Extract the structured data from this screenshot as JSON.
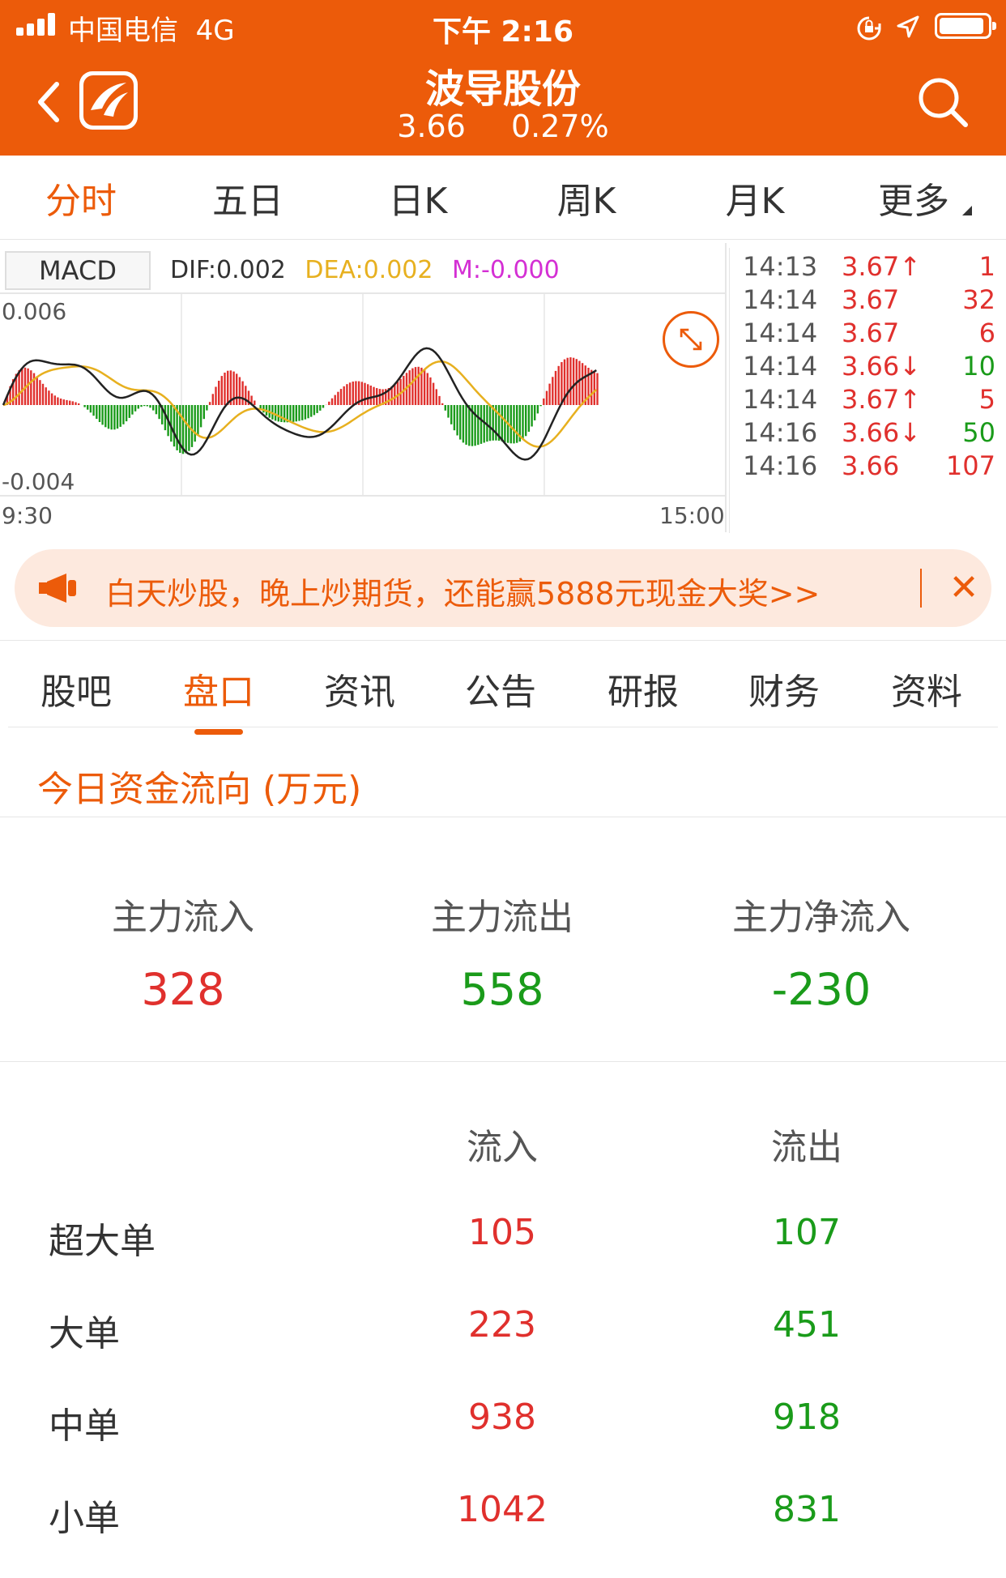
{
  "status_bar": {
    "carrier": "中国电信",
    "network": "4G",
    "time": "下午 2:16"
  },
  "header": {
    "title": "波导股份",
    "price": "3.66",
    "change_pct": "0.27%"
  },
  "chart_tabs": [
    "分时",
    "五日",
    "日K",
    "周K",
    "月K",
    "更多"
  ],
  "chart_tabs_active": "分时",
  "macd": {
    "button": "MACD",
    "dif": "DIF:0.002",
    "dea": "DEA:0.002",
    "m": "M:-0.000",
    "y_top": "0.006",
    "y_bottom": "-0.004",
    "x_start": "9:30",
    "x_end": "15:00"
  },
  "ticks": [
    {
      "time": "14:13",
      "price": "3.67↑",
      "vol": "1",
      "price_color": "red",
      "vol_color": "red"
    },
    {
      "time": "14:14",
      "price": "3.67",
      "vol": "32",
      "price_color": "red",
      "vol_color": "red"
    },
    {
      "time": "14:14",
      "price": "3.67",
      "vol": "6",
      "price_color": "red",
      "vol_color": "red"
    },
    {
      "time": "14:14",
      "price": "3.66↓",
      "vol": "10",
      "price_color": "red",
      "vol_color": "green"
    },
    {
      "time": "14:14",
      "price": "3.67↑",
      "vol": "5",
      "price_color": "red",
      "vol_color": "red"
    },
    {
      "time": "14:16",
      "price": "3.66↓",
      "vol": "50",
      "price_color": "red",
      "vol_color": "green"
    },
    {
      "time": "14:16",
      "price": "3.66",
      "vol": "107",
      "price_color": "red",
      "vol_color": "red"
    }
  ],
  "banner": {
    "text": "白天炒股，晚上炒期货，还能赢5888元现金大奖>>",
    "close": "✕"
  },
  "section_tabs": [
    "股吧",
    "盘口",
    "资讯",
    "公告",
    "研报",
    "财务",
    "资料"
  ],
  "section_tabs_active": "盘口",
  "fund_flow": {
    "title": "今日资金流向 (万元)",
    "main": [
      {
        "label": "主力流入",
        "value": "328",
        "color": "red"
      },
      {
        "label": "主力流出",
        "value": "558",
        "color": "green"
      },
      {
        "label": "主力净流入",
        "value": "-230",
        "color": "green"
      }
    ],
    "col_in": "流入",
    "col_out": "流出",
    "rows": [
      {
        "label": "超大单",
        "in": "105",
        "out": "107"
      },
      {
        "label": "大单",
        "in": "223",
        "out": "451"
      },
      {
        "label": "中单",
        "in": "938",
        "out": "918"
      },
      {
        "label": "小单",
        "in": "1042",
        "out": "831"
      }
    ]
  },
  "colors": {
    "brand": "#ec5b0a",
    "up": "#e0302d",
    "down": "#1a9b1a",
    "dea": "#e7b01f",
    "m": "#d42fd4"
  },
  "icons": [
    "back-arrow-icon",
    "app-logo-icon",
    "search-icon",
    "expand-icon",
    "megaphone-icon",
    "close-icon"
  ]
}
